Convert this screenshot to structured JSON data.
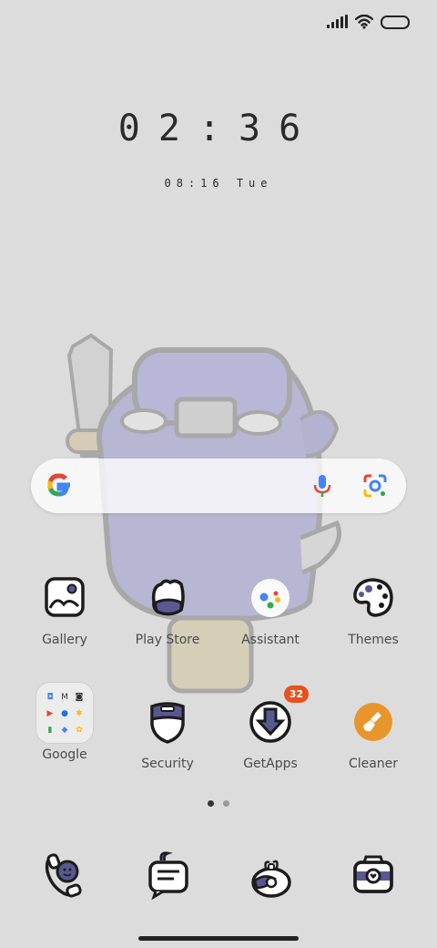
{
  "status": {
    "signal": "signal-icon",
    "wifi": "wifi-icon",
    "battery": "battery-icon"
  },
  "clock": {
    "time": "02:36",
    "date": "08:16 Tue"
  },
  "search": {
    "google_icon": "google-g-icon",
    "mic_icon": "mic-icon",
    "lens_icon": "lens-icon"
  },
  "apps": [
    {
      "label": "Gallery"
    },
    {
      "label": "Play Store"
    },
    {
      "label": "Assistant"
    },
    {
      "label": "Themes"
    },
    {
      "label": "Google"
    },
    {
      "label": "Security"
    },
    {
      "label": "GetApps",
      "badge": "32"
    },
    {
      "label": "Cleaner"
    }
  ],
  "dock": [
    {
      "name": "phone-icon"
    },
    {
      "name": "messages-icon"
    },
    {
      "name": "browser-icon"
    },
    {
      "name": "camera-icon"
    }
  ],
  "pages": {
    "current": 1,
    "total": 2
  },
  "colors": {
    "badge": "#e8501c",
    "cleaner": "#e8962c",
    "accent": "#5a5890"
  }
}
